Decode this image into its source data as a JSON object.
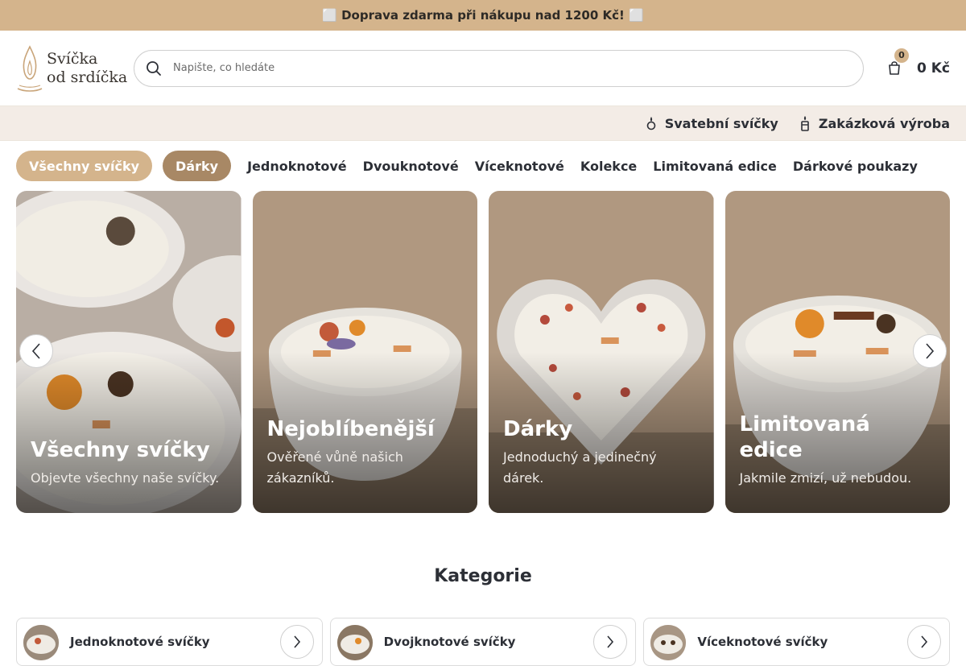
{
  "announcement": {
    "text": "⬜ Doprava zdarma při nákupu nad 1200 Kč! ⬜"
  },
  "header": {
    "logo_line1": "Svíčka",
    "logo_line2": "od srdíčka",
    "search_placeholder": "Napište, co hledáte",
    "cart_count": "0",
    "cart_total": "0 Kč"
  },
  "secondary_nav": [
    {
      "label": "Svatební svíčky",
      "icon": "candle-ring-icon"
    },
    {
      "label": "Zakázková výroba",
      "icon": "candle-icon"
    }
  ],
  "categories_nav": {
    "pills": [
      "Všechny svíčky",
      "Dárky"
    ],
    "links": [
      "Jednoknotové",
      "Dvouknotové",
      "Víceknotové",
      "Kolekce",
      "Limitovaná edice",
      "Dárkové poukazy"
    ]
  },
  "hero_cards": [
    {
      "title": "Všechny svíčky",
      "subtitle": "Objevte všechny naše svíčky."
    },
    {
      "title": "Nejoblíbenější",
      "subtitle": "Ověřené vůně našich zákazníků."
    },
    {
      "title": "Dárky",
      "subtitle": "Jednoduchý a jedinečný dárek."
    },
    {
      "title": "Limitovaná edice",
      "subtitle": "Jakmile zmizí, už nebudou."
    }
  ],
  "section": {
    "title": "Kategorie"
  },
  "category_cards": [
    {
      "label": "Jednoknotové svíčky"
    },
    {
      "label": "Dvojknotové svíčky"
    },
    {
      "label": "Víceknotové svíčky"
    }
  ],
  "colors": {
    "accent": "#d4b48c",
    "accent_dark": "#a88865",
    "secondary_bg": "#f3ece6",
    "text": "#2c2f36"
  }
}
